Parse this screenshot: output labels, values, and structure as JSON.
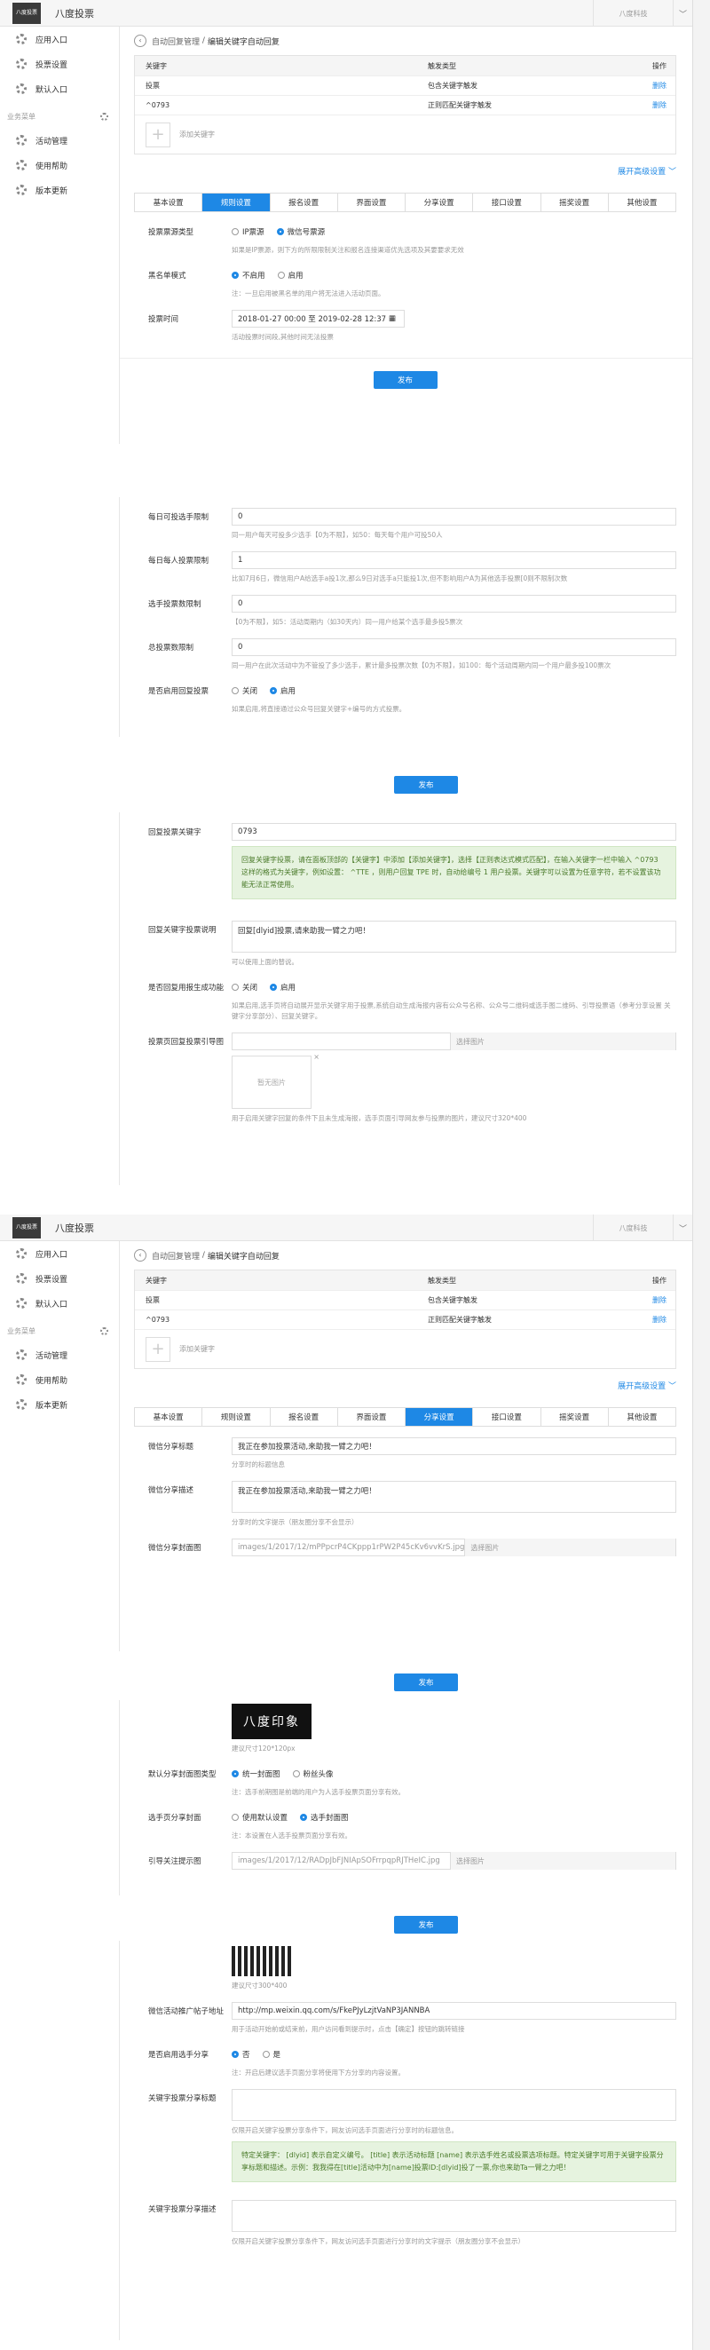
{
  "app": {
    "title": "八度投票",
    "logo_text": "八度投票",
    "account": "八度科技",
    "caret": "﹀"
  },
  "sidebar": {
    "items": [
      "应用入口",
      "投票设置",
      "默认入口"
    ],
    "section": "业务菜单",
    "sub_items": [
      "活动管理",
      "使用帮助",
      "版本更新"
    ]
  },
  "breadcrumb": {
    "parent": "自动回复管理",
    "sep": "/",
    "current": "编辑关键字自动回复"
  },
  "keyword_table": {
    "headers": [
      "关键字",
      "触发类型",
      "操作"
    ],
    "rows": [
      {
        "keyword": "投票",
        "type": "包含关键字触发",
        "action": "删除"
      },
      {
        "keyword": "^0793",
        "type": "正则匹配关键字触发",
        "action": "删除"
      }
    ],
    "add_label": "添加关键字",
    "plus": "+"
  },
  "advanced_label": "展开高级设置",
  "tabs": [
    "基本设置",
    "规则设置",
    "报名设置",
    "界面设置",
    "分享设置",
    "接口设置",
    "摇奖设置",
    "其他设置"
  ],
  "publish_label": "发布",
  "rules": {
    "source_label": "投票票源类型",
    "source_options": [
      "IP票源",
      "微信号票源"
    ],
    "source_help": "如果是IP票源，则下方的所限限制关注和报名连接渠道优先选项及其要要求无效",
    "single_label": "黑名单模式",
    "single_options": [
      "不启用",
      "启用"
    ],
    "single_help": "注：一旦启用被黑名单的用户将无法进入活动页面。",
    "time_label": "投票时间",
    "time_value": "2018-01-27 00:00 至 2019-02-28 12:37",
    "time_help": "活动投票时间段,其他时间无法投票"
  },
  "limits": {
    "daily_label": "每日可投选手限制",
    "daily_value": "0",
    "daily_help": "同一用户每天可投多少选手【0为不限】，如50：每天每个用户可投50人",
    "per_label": "每日每人投票限制",
    "per_value": "1",
    "per_help": "比如7月6日，微信用户A给选手a投1次,那么9日对选手a只能投1次,但不影响用户A为其他选手投票[0则不限制次数",
    "total_label": "选手投票数限制",
    "total_value": "0",
    "total_help": "【0为不限】，如5：活动周期内（如30天内）同一用户给某个选手最多投5票次",
    "sum_label": "总投票数限制",
    "sum_value": "0",
    "sum_help": "同一用户在此次活动中为不管投了多少选手，累计最多投票次数【0为不限】，如100：每个活动周期内同一个用户最多投100票次",
    "reply_label": "是否启用回复投票",
    "reply_options": [
      "关闭",
      "启用"
    ],
    "reply_help": "如果启用,将直接通过公众号回复关键字+编号的方式投票。"
  },
  "reply": {
    "kw_label": "回复投票关键字",
    "kw_value": "0793",
    "green_text": "回复关键字投票，请在面板顶部的【关键字】中添加【添加关键字】，选择【正则表达式模式匹配】，在输入关键字一栏中输入 ^0793 这样的格式为关键字，例如设置： ^TTE ，则用户回复 TPE 时，自动给编号 1 用户投票。关键字可以设置为任意字符，若不设置该功能无法正常使用。",
    "desc_label": "回复关键字投票说明",
    "desc_value": "回复[dlyid]投票,请来助我一臂之力吧！",
    "desc_help": "可以使用上面的替说。",
    "mode_label": "是否回复用报生成功能",
    "mode_options": [
      "关闭",
      "启用"
    ],
    "mode_help": "如果启用,选手页将自动展开显示关键字用于投票,系统自动生成海报内容有公众号名称、公众号二维码或选手图二维码、引导投票语（参考分享设置 关键字分享部分）、回复关键字。",
    "img_label": "投票页回复投票引导图",
    "img_btn": "选择图片",
    "img_placeholder": "暂无图片",
    "img_close": "×",
    "img_help": "用于启用关键字回复的条件下且未生成海报，选手页面引导网友参与投票的图片，建议尺寸320*400"
  },
  "share": {
    "title_label": "微信分享标题",
    "title_value": "我正在参加投票活动,来助我一臂之力吧！",
    "title_help": "分享时的标题信息",
    "desc_label": "微信分享描述",
    "desc_value": "我正在参加投票活动,来助我一臂之力吧！",
    "desc_help": "分享时的文字提示（朋友圈分享不会显示）",
    "cover_label": "微信分享封面图",
    "cover_value": "images/1/2017/12/mPPpcrP4CKppp1rPW2P45cKv6vvKrS.jpg",
    "cover_btn": "选择图片",
    "logo_img_text": "八度印象",
    "cover_help": "建议尺寸120*120px",
    "default_label": "默认分享封面图类型",
    "default_options": [
      "统一封面图",
      "粉丝头像"
    ],
    "default_help": "注：选手前期图是前端的用户为人选手投票页面分享有效。",
    "player_label": "选手页分享封面",
    "player_options": [
      "使用默认设置",
      "选手封面图"
    ],
    "player_help": "注：本设置在人选手投票页面分享有效。",
    "guide_label": "引导关注提示图",
    "guide_value": "images/1/2017/12/RADpJbFJNIApSOFrrpqpRJTHeIC.jpg",
    "guide_btn": "选择图片",
    "guide_help": "建议尺寸300*400",
    "url_label": "微信活动推广帖子地址",
    "url_value": "http://mp.weixin.qq.com/s/FkePJyLzjtVaNP3JANNBA",
    "url_help": "用于活动开始前或结束前，用户访问看到提示时，点击【确定】按钮的跳转链接",
    "player_share_label": "是否启用选手分享",
    "player_share_options": [
      "否",
      "是"
    ],
    "player_share_help": "注：开启后建议选手页面分享将使用下方分享的内容设置。",
    "kw_title_label": "关键字投票分享标题",
    "kw_title_help": "仅限开启关键字投票分享条件下，网友访问选手页面进行分享时的标题信息。",
    "kw_green": "特定关键字： [dlyid] 表示自定义编号。 [title] 表示活动标题 [name] 表示选手姓名或投票选项标题。特定关键字可用于关键字投票分享标题和描述。示例：我我得在[title]活动中为[name]投票ID:[dlyid]投了一票,你也来助Ta一臂之力吧！",
    "kw_desc_label": "关键字投票分享描述",
    "kw_desc_help": "仅限开启关键字投票分享条件下，网友访问选手页面进行分享时的文字提示（朋友圈分享不会显示）"
  }
}
